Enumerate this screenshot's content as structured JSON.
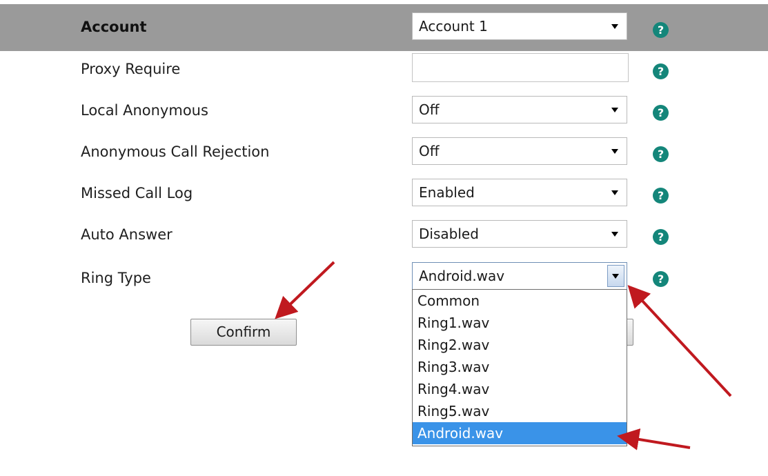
{
  "header": {
    "label": "Account",
    "select_value": "Account 1"
  },
  "rows": [
    {
      "label": "Proxy Require",
      "value": ""
    },
    {
      "label": "Local Anonymous",
      "value": "Off"
    },
    {
      "label": "Anonymous Call Rejection",
      "value": "Off"
    },
    {
      "label": "Missed Call Log",
      "value": "Enabled"
    },
    {
      "label": "Auto Answer",
      "value": "Disabled"
    },
    {
      "label": "Ring Type",
      "value": "Android.wav"
    }
  ],
  "help_icon_glyph": "?",
  "buttons": {
    "confirm_label": "Confirm"
  },
  "ring_type_dropdown": {
    "options": [
      "Common",
      "Ring1.wav",
      "Ring2.wav",
      "Ring3.wav",
      "Ring4.wav",
      "Ring5.wav",
      "Android.wav"
    ],
    "selected": "Android.wav"
  },
  "colors": {
    "header_bar": "#9a9a9a",
    "help_icon": "#14867a",
    "selected_option": "#3a93e8",
    "annotation_arrow": "#c0191f"
  },
  "icons": {
    "help": "question-circle-icon",
    "dropdown": "chevron-down-icon",
    "annotation": "arrow-icon"
  }
}
